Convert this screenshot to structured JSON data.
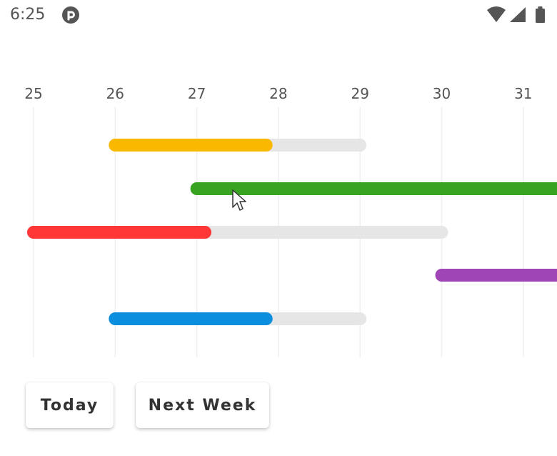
{
  "status_bar": {
    "time": "6:25",
    "app_icon": "pebble-app-icon",
    "wifi_icon": "wifi-icon",
    "signal_icon": "cell-signal-icon",
    "battery_icon": "battery-icon"
  },
  "timeline": {
    "days": [
      "25",
      "26",
      "27",
      "28",
      "29",
      "30",
      "31"
    ],
    "bars": [
      {
        "start": 26.0,
        "end": 29.0,
        "progress_end": 27.85,
        "color": "#FBB800",
        "track_color": "#E6E6E6"
      },
      {
        "start": 27.0,
        "end": 32.5,
        "progress_end": 32.5,
        "color": "#38A320",
        "track_color": "#E6E6E6"
      },
      {
        "start": 25.0,
        "end": 30.0,
        "progress_end": 27.1,
        "color": "#FF3737",
        "track_color": "#E6E6E6"
      },
      {
        "start": 30.0,
        "end": 32.5,
        "progress_end": 32.5,
        "color": "#A045B5",
        "track_color": "#E6E6E6"
      },
      {
        "start": 26.0,
        "end": 29.0,
        "progress_end": 27.85,
        "color": "#0A8EDD",
        "track_color": "#E6E6E6"
      }
    ]
  },
  "buttons": {
    "today": "Today",
    "next_week": "Next Week"
  },
  "cursor": "mouse-pointer-icon"
}
